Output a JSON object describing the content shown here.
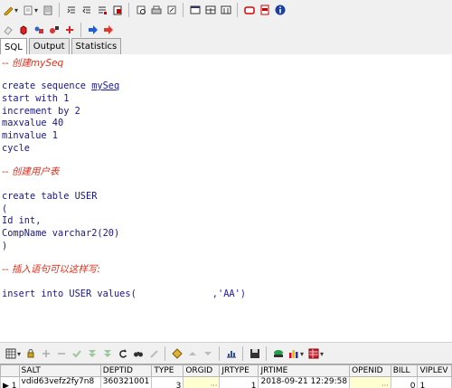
{
  "toolbar_top": {
    "buttons": [
      "pencil-icon",
      "chevron-down-icon",
      "back-icon",
      "chevron-down-icon",
      "save-icon",
      "indent-icon",
      "outdent-icon",
      "comment-icon",
      "uncomment-icon",
      "print-preview-icon",
      "print-icon",
      "tools-icon",
      "window-icon",
      "split-icon",
      "tile-icon",
      "stop-icon",
      "pdf-icon",
      "info-icon"
    ]
  },
  "toolbar_second": {
    "buttons": [
      "eraser-icon",
      "cube-red-icon",
      "shapes-icon",
      "dependency-icon",
      "cross-tool-icon",
      "arrow-right-blue-icon",
      "arrow-right-red-icon"
    ]
  },
  "tabs": [
    {
      "label": "SQL",
      "active": true
    },
    {
      "label": "Output",
      "active": false
    },
    {
      "label": "Statistics",
      "active": false
    }
  ],
  "editor": {
    "comment1": "-- 创建mySeq",
    "l_create_seq_kw": "create sequence ",
    "l_create_seq_name": "mySeq",
    "l_start": "start with 1",
    "l_increment": "increment by 2",
    "l_maxvalue": "maxvalue 40",
    "l_minvalue": "minvalue 1",
    "l_cycle": "cycle",
    "comment2": "-- 创建用户表",
    "l_create_table": "create table USER",
    "l_paren_open": "(",
    "l_id": "Id int,",
    "l_compname": "CompName varchar2(20)",
    "l_paren_close": ")",
    "comment3": "-- 插入语句可以这样写:",
    "l_insert": "insert into USER values(",
    "l_insert_val": ",'AA')"
  },
  "grid_toolbar": {
    "buttons": [
      "grid-icon",
      "dropdown-icon",
      "lock-icon",
      "add-record-icon",
      "delete-record-icon",
      "post-icon",
      "filter-icon",
      "filter2-icon",
      "refresh-icon",
      "binoculars-icon",
      "clear-icon",
      "query-icon",
      "up-icon",
      "down-icon",
      "chart-bars-icon",
      "save-icon",
      "export-icon",
      "bar-chart-icon",
      "table-icon"
    ]
  },
  "grid": {
    "columns": [
      "",
      "SALT",
      "DEPTID",
      "TYPE",
      "ORGID",
      "JRTYPE",
      "JRTIME",
      "OPENID",
      "BILL",
      "VIPLEV"
    ],
    "rows": [
      {
        "indicator": "1",
        "salt": "vdid63vefz2fy7n8",
        "deptid": "360321001",
        "type": "3",
        "orgid": "",
        "jrtype": "1",
        "jrtime": "2018-09-21 12:29:58",
        "openid": "",
        "bill": "0",
        "viplev": "1"
      }
    ]
  },
  "colors": {
    "comment": "#e0301e",
    "keyword": "#19178c",
    "background": "#f0f0f0"
  }
}
